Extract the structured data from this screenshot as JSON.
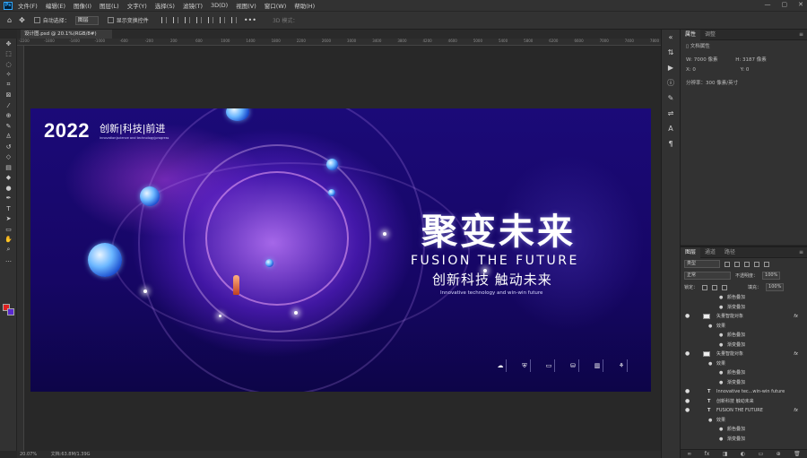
{
  "app": {
    "logo": "Ps",
    "menu": [
      "文件(F)",
      "编辑(E)",
      "图像(I)",
      "图层(L)",
      "文字(Y)",
      "选择(S)",
      "滤镜(T)",
      "3D(D)",
      "视图(V)",
      "窗口(W)",
      "帮助(H)"
    ],
    "window_controls": [
      "—",
      "▢",
      "✕"
    ]
  },
  "options_bar": {
    "auto_select_label": "自动选择：",
    "auto_select_value": "图层",
    "show_transform_label": "显示变换控件",
    "mode_3d": "3D 模式："
  },
  "document": {
    "tab_title": "设计图.psd @ 20.1%(RGB/8#)",
    "ruler_ticks": [
      "-2200",
      "-2000",
      "-1800",
      "-1600",
      "-1400",
      "-1200",
      "-1000",
      "-800",
      "-600",
      "-400",
      "-200",
      "0",
      "200",
      "400",
      "600",
      "800",
      "1000",
      "1200",
      "1400",
      "1600",
      "1800",
      "2000",
      "2200",
      "2400",
      "2600",
      "2800",
      "3000",
      "3200",
      "3400",
      "3600",
      "3800",
      "4000",
      "4200",
      "4400",
      "4600",
      "4800",
      "5000",
      "5200",
      "5400",
      "5600",
      "5800",
      "6000",
      "6200",
      "6400",
      "6600",
      "6800",
      "7000",
      "7200",
      "7400",
      "7600",
      "7800"
    ],
    "status_zoom": "20.07%",
    "status_doc": "文档:63.8M/1.39G"
  },
  "design": {
    "year": "2022",
    "subtitle": "创新|科技|前进",
    "tiny_text": "innovation|science and technology|progress",
    "headline": "聚变未来",
    "fusion": "FUSION THE FUTURE",
    "cn_slogan": "创新科技  触动未来",
    "en_slogan": "Innovative technology and win-win future",
    "bottom_icons": [
      "☁",
      "⛨",
      "▭",
      "⛁",
      "▥",
      "⚘"
    ]
  },
  "properties_panel": {
    "tabs": [
      "属性",
      "调整"
    ],
    "section": "文档属性",
    "width": "W: 7000 像素",
    "height": "H: 3187 像素",
    "x": "X: 0",
    "y": "Y: 0",
    "resolution": "分辨率：300 像素/英寸"
  },
  "layers_panel": {
    "tabs": [
      "图层",
      "通道",
      "路径"
    ],
    "filter_kind": "类型",
    "blend_mode": "正常",
    "opacity_label": "不透明度：",
    "opacity_value": "100%",
    "lock_label": "锁定：",
    "fill_label": "填充：",
    "fill_value": "100%",
    "rows": [
      {
        "kind": "effect",
        "label": "颜色叠加"
      },
      {
        "kind": "effect",
        "label": "渐变叠加"
      },
      {
        "kind": "smart",
        "label": "矢量智能对象",
        "fx": "fx"
      },
      {
        "kind": "group",
        "label": "效果"
      },
      {
        "kind": "effect",
        "label": "颜色叠加"
      },
      {
        "kind": "effect",
        "label": "渐变叠加"
      },
      {
        "kind": "smart",
        "label": "矢量智能对象",
        "fx": "fx"
      },
      {
        "kind": "group",
        "label": "效果"
      },
      {
        "kind": "effect",
        "label": "颜色叠加"
      },
      {
        "kind": "effect",
        "label": "渐变叠加"
      },
      {
        "kind": "text",
        "label": "Innovative tec...win-win future"
      },
      {
        "kind": "text",
        "label": "创新科技  触动未来"
      },
      {
        "kind": "text",
        "label": "FUSION  THE  FUTURE",
        "fx": "fx"
      },
      {
        "kind": "group",
        "label": "效果"
      },
      {
        "kind": "effect",
        "label": "颜色叠加"
      },
      {
        "kind": "effect",
        "label": "渐变叠加"
      }
    ],
    "footer_icons": [
      "∞",
      "fx",
      "◨",
      "◐",
      "▭",
      "⊕",
      "🗑"
    ]
  },
  "colors": {
    "foreground": "#e02020",
    "background": "#5a2ad0"
  }
}
